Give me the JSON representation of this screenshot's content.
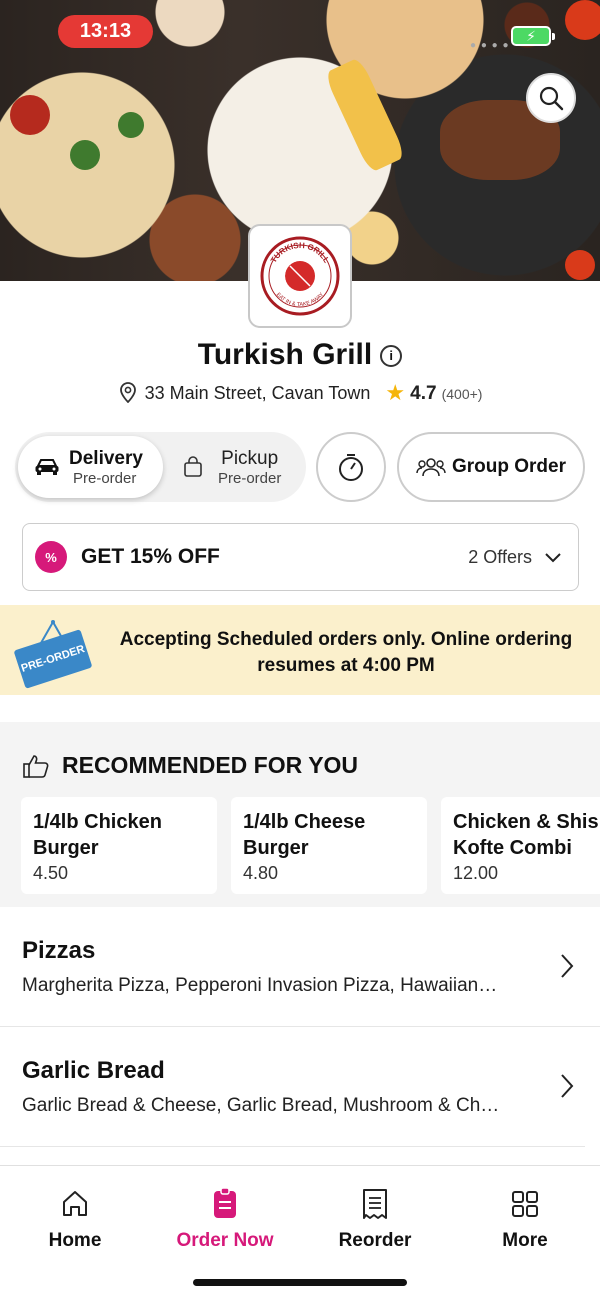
{
  "status_bar": {
    "time": "13:13",
    "battery_icon": "battery-charging-icon"
  },
  "restaurant": {
    "name": "Turkish Grill",
    "logo_text_top": "TURKISH GRILL",
    "logo_text_bottom": "EAT IN & TAKE AWAY",
    "address": "33 Main Street, Cavan Town",
    "rating": "4.7",
    "rating_count": "(400+)"
  },
  "order_mode": {
    "delivery": {
      "label": "Delivery",
      "sub": "Pre-order"
    },
    "pickup": {
      "label": "Pickup",
      "sub": "Pre-order"
    },
    "group_order_label": "Group Order"
  },
  "offer": {
    "badge": "%",
    "title": "GET 15% OFF",
    "count": "2 Offers"
  },
  "notice": {
    "tag": "PRE-ORDER",
    "text": "Accepting Scheduled orders only. Online ordering resumes at 4:00 PM"
  },
  "recommended": {
    "heading": "RECOMMENDED FOR YOU",
    "items": [
      {
        "name": "1/4lb Chicken\nBurger",
        "price": "4.50"
      },
      {
        "name": "1/4lb Cheese\nBurger",
        "price": "4.80"
      },
      {
        "name": "Chicken & Shish\nKofte Combi",
        "price": "12.00"
      }
    ]
  },
  "categories": [
    {
      "name": "Pizzas",
      "desc": "Margherita Pizza, Pepperoni Invasion Pizza, Hawaiian…"
    },
    {
      "name": "Garlic Bread",
      "desc": "Garlic Bread & Cheese, Garlic Bread, Mushroom & Ch…"
    }
  ],
  "nav": [
    {
      "label": "Home",
      "icon": "home-icon"
    },
    {
      "label": "Order Now",
      "icon": "order-icon"
    },
    {
      "label": "Reorder",
      "icon": "receipt-icon"
    },
    {
      "label": "More",
      "icon": "grid-icon"
    }
  ],
  "colors": {
    "accent": "#d6197a",
    "status_red": "#e53935",
    "notice_bg": "#fbf0cc",
    "star": "#f5b50a"
  }
}
